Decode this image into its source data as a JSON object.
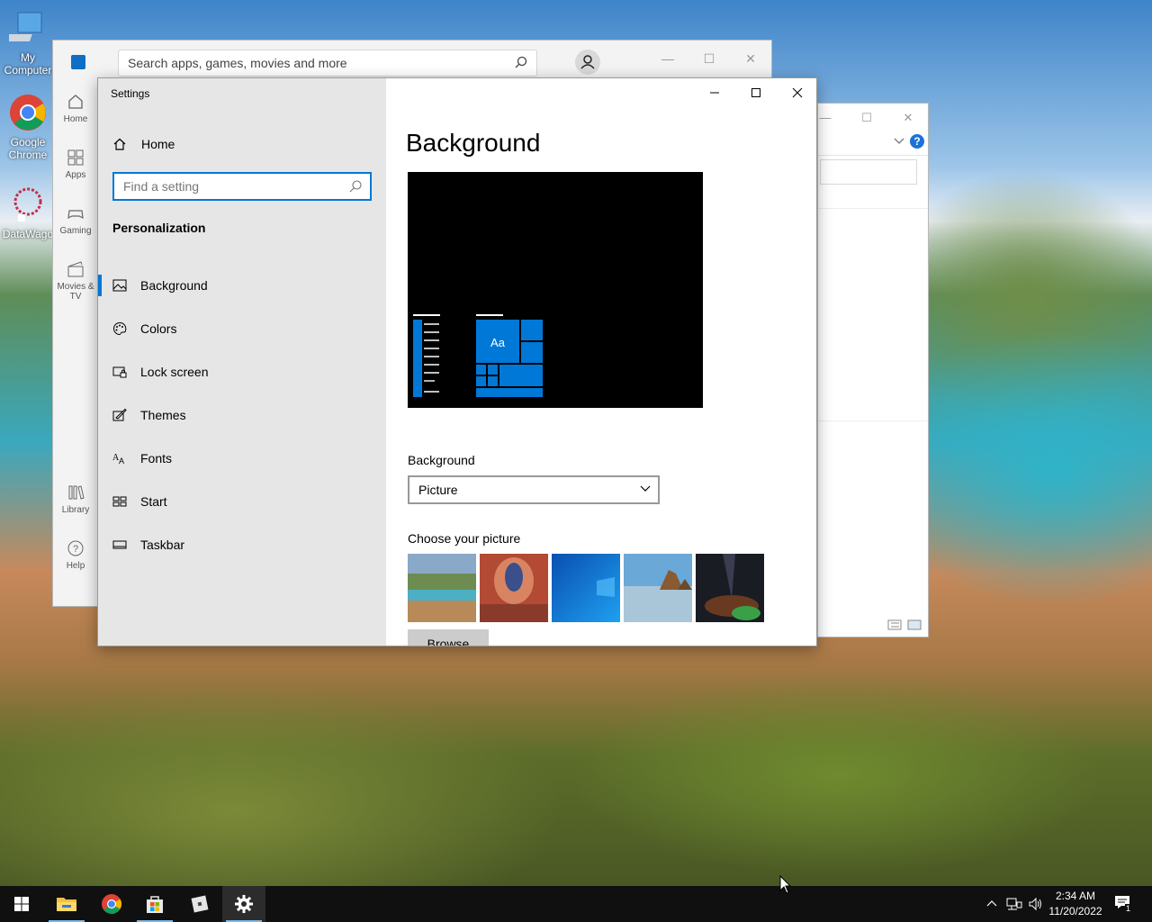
{
  "desktop": {
    "icons": [
      {
        "label": "My Computer"
      },
      {
        "label": "Google Chrome"
      },
      {
        "label": "DataWago"
      }
    ]
  },
  "store": {
    "search_placeholder": "Search apps, games, movies and more",
    "nav": [
      {
        "label": "Home",
        "icon": "home-icon"
      },
      {
        "label": "Apps",
        "icon": "apps-icon"
      },
      {
        "label": "Gaming",
        "icon": "gamepad-icon"
      },
      {
        "label": "Movies & TV",
        "icon": "clapper-icon"
      },
      {
        "label": "Library",
        "icon": "library-icon"
      },
      {
        "label": "Help",
        "icon": "help-icon"
      }
    ]
  },
  "settings": {
    "window_title": "Settings",
    "home_label": "Home",
    "search_placeholder": "Find a setting",
    "section_header": "Personalization",
    "nav": [
      {
        "label": "Background",
        "icon": "picture-icon",
        "active": true
      },
      {
        "label": "Colors",
        "icon": "palette-icon",
        "active": false
      },
      {
        "label": "Lock screen",
        "icon": "lock-screen-icon",
        "active": false
      },
      {
        "label": "Themes",
        "icon": "themes-brush-icon",
        "active": false
      },
      {
        "label": "Fonts",
        "icon": "fonts-icon",
        "active": false
      },
      {
        "label": "Start",
        "icon": "start-tiles-icon",
        "active": false
      },
      {
        "label": "Taskbar",
        "icon": "taskbar-icon",
        "active": false
      }
    ],
    "page_title": "Background",
    "preview_tile_text": "Aa",
    "background_label": "Background",
    "background_value": "Picture",
    "choose_label": "Choose your picture",
    "browse_label": "Browse",
    "accent_color": "#0078d7"
  },
  "taskbar": {
    "time": "2:34 AM",
    "date": "11/20/2022",
    "notification_count": "1"
  }
}
